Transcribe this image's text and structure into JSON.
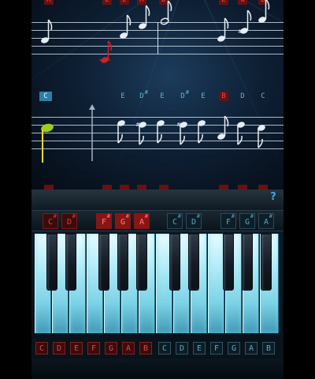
{
  "top_screen": {
    "upper_labels": [
      {
        "text": "A",
        "style": "red"
      },
      {
        "text": "E",
        "style": "red"
      },
      {
        "text": "E",
        "style": "red"
      },
      {
        "text": "A",
        "style": "red"
      },
      {
        "text": "D",
        "style": "red"
      },
      {
        "text": "E",
        "style": "red"
      },
      {
        "text": "G",
        "style": "red"
      },
      {
        "text": "B",
        "style": "red"
      }
    ],
    "current_note_label": "C",
    "sequence_labels": [
      {
        "text": "E",
        "style": "plain",
        "sharp": ""
      },
      {
        "text": "D",
        "style": "plain",
        "sharp": "#"
      },
      {
        "text": "E",
        "style": "plain",
        "sharp": ""
      },
      {
        "text": "D",
        "style": "plain",
        "sharp": "#"
      },
      {
        "text": "E",
        "style": "plain",
        "sharp": ""
      },
      {
        "text": "B",
        "style": "red",
        "sharp": ""
      },
      {
        "text": "D",
        "style": "plain",
        "sharp": ""
      },
      {
        "text": "C",
        "style": "plain",
        "sharp": ""
      }
    ]
  },
  "bottom_screen": {
    "help_label": "?",
    "upper_key_labels": [
      {
        "text": "C",
        "sharp": "#",
        "style": "red"
      },
      {
        "text": "D",
        "sharp": "#",
        "style": "red"
      },
      {
        "text": "F",
        "sharp": "#",
        "style": "red hi"
      },
      {
        "text": "G",
        "sharp": "#",
        "style": "red hi"
      },
      {
        "text": "A",
        "sharp": "#",
        "style": "red hi"
      },
      {
        "text": "C",
        "sharp": "#",
        "style": "blue"
      },
      {
        "text": "D",
        "sharp": "#",
        "style": "blue"
      },
      {
        "text": "F",
        "sharp": "#",
        "style": "blue"
      },
      {
        "text": "G",
        "sharp": "#",
        "style": "blue"
      },
      {
        "text": "A",
        "sharp": "#",
        "style": "blue"
      }
    ],
    "lower_note_labels": [
      {
        "text": "C",
        "style": "red"
      },
      {
        "text": "D",
        "style": "red"
      },
      {
        "text": "E",
        "style": "red"
      },
      {
        "text": "F",
        "style": "red"
      },
      {
        "text": "G",
        "style": "red"
      },
      {
        "text": "A",
        "style": "red"
      },
      {
        "text": "B",
        "style": "red"
      },
      {
        "text": "C",
        "style": "blue"
      },
      {
        "text": "D",
        "style": "blue"
      },
      {
        "text": "E",
        "style": "blue"
      },
      {
        "text": "F",
        "style": "blue"
      },
      {
        "text": "G",
        "style": "blue"
      },
      {
        "text": "A",
        "style": "blue"
      },
      {
        "text": "B",
        "style": "blue"
      }
    ]
  },
  "colors": {
    "red_label": "#e05050",
    "blue_label": "#5fb6c8",
    "current_note": "#2f7ea6",
    "active_note": "#d02020",
    "cursor_note": "#9ad020"
  }
}
